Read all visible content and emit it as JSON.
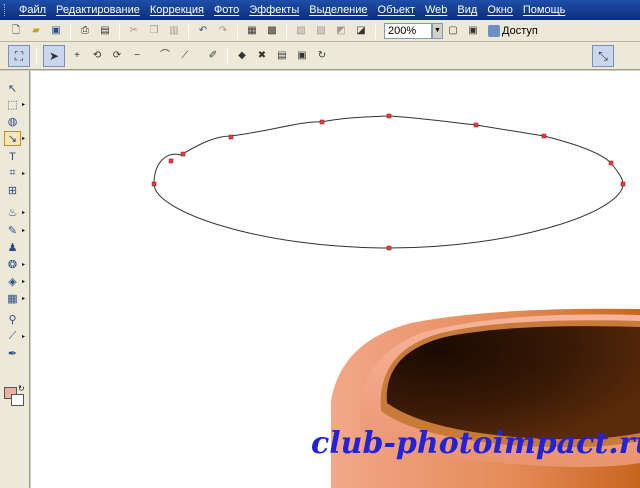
{
  "menu": {
    "items": [
      "Файл",
      "Редактирование",
      "Коррекция",
      "Фото",
      "Эффекты",
      "Выделение",
      "Объект",
      "Web",
      "Вид",
      "Окно",
      "Помощь"
    ]
  },
  "toolbar1": {
    "icons": [
      "new-icon",
      "open-icon",
      "save-icon",
      "print-icon",
      "preview-icon",
      "cut-icon",
      "copy-icon",
      "paste-icon",
      "undo-icon",
      "redo-icon",
      "scan-icon",
      "capture-icon",
      "grid-icon",
      "layers-icon",
      "palette-icon",
      "fill-icon"
    ],
    "zoom_value": "200%",
    "share_label": "Доступ"
  },
  "toolbar2": {
    "icons": [
      "path-mode-icon",
      "select-pointer-icon",
      "add-point-icon",
      "curve-icon",
      "smooth-icon",
      "delete-point-icon",
      "curve-segment-icon",
      "line-segment-icon",
      "break-icon",
      "join-icon",
      "close-path-icon",
      "align-icon",
      "distribute-icon",
      "refresh-icon",
      "path-edit-icon"
    ]
  },
  "toolbox": {
    "tools": [
      "pick-tool-icon",
      "selection-tool-icon",
      "lasso-tool-icon",
      "path-edit-tool-icon",
      "text-tool-icon",
      "crop-tool-icon",
      "transform-tool-icon",
      "fill-tool-icon",
      "paint-brush-icon",
      "clone-tool-icon",
      "retouch-tool-icon",
      "eraser-tool-icon",
      "gradient-tool-icon",
      "zoom-tool-icon",
      "eyedropper-tool-icon",
      "pen-tool-icon"
    ],
    "foreground_color": "#f0b0a0",
    "background_color": "#ffffff"
  },
  "canvas": {
    "watermark": "club-photoimpact.ru",
    "pot_rim_color": "#f3a890",
    "pot_interior_color": "#3a1a08",
    "pot_glow_color": "#c86a1a"
  }
}
